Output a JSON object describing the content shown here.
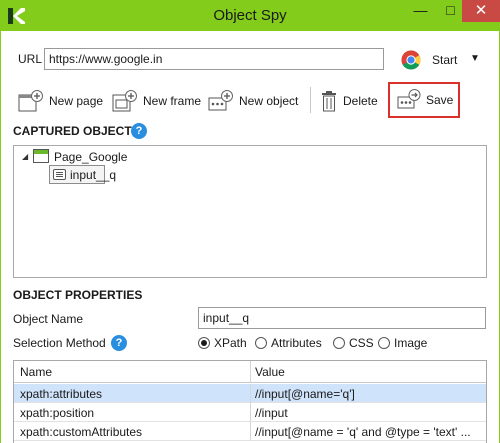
{
  "window": {
    "title": "Object Spy",
    "minimize": "—",
    "maximize": "□",
    "close": "✕"
  },
  "url_bar": {
    "label": "URL",
    "value": "https://www.google.in",
    "start_label": "Start",
    "start_caret": "▼"
  },
  "toolbar": {
    "new_page": "New page",
    "new_frame": "New frame",
    "new_object": "New object",
    "delete": "Delete",
    "save": "Save"
  },
  "captured": {
    "heading": "CAPTURED OBJECTS",
    "help": "?",
    "tree": {
      "caret": "◢",
      "page": "Page_Google",
      "object": "input__q"
    }
  },
  "properties": {
    "heading": "OBJECT PROPERTIES",
    "object_name_label": "Object Name",
    "object_name_value": "input__q",
    "selection_method_label": "Selection Method",
    "help": "?",
    "methods": [
      "XPath",
      "Attributes",
      "CSS",
      "Image"
    ],
    "selected_method": "XPath",
    "grid": {
      "columns": [
        "Name",
        "Value"
      ],
      "rows": [
        {
          "name": "xpath:attributes",
          "value": "//input[@name='q']"
        },
        {
          "name": "xpath:position",
          "value": "//input"
        },
        {
          "name": "xpath:customAttributes",
          "value": "//input[@name = 'q' and @type = 'text' ..."
        }
      ]
    }
  },
  "colors": {
    "titlebar": "#83cc1c",
    "close_button": "#c94a45",
    "save_highlight": "#d9302c",
    "help_icon": "#2a8ee0",
    "selected_row": "#cfe3fa"
  }
}
